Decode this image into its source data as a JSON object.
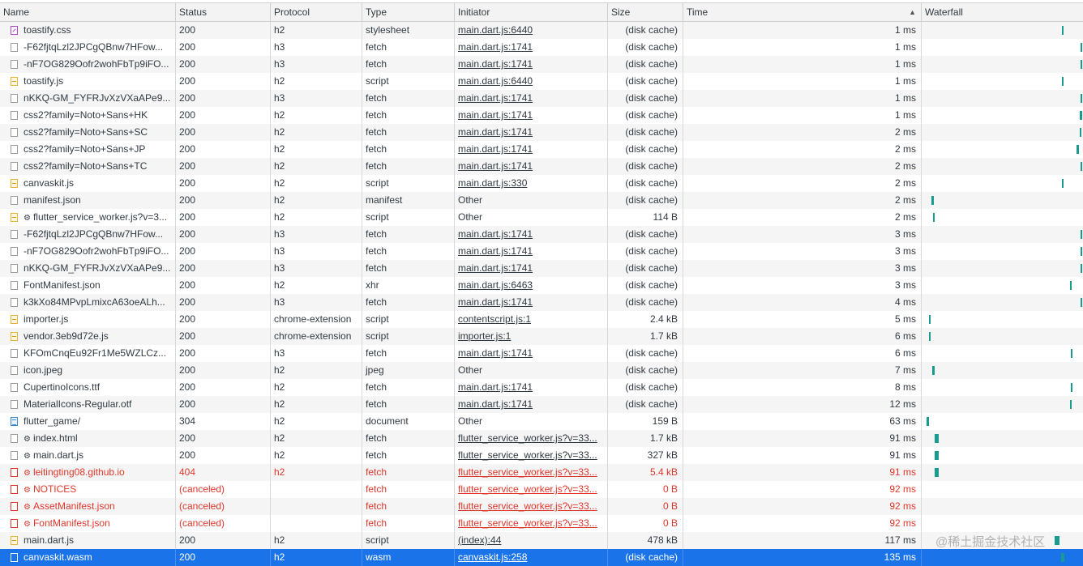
{
  "columns": {
    "name": "Name",
    "status": "Status",
    "protocol": "Protocol",
    "type": "Type",
    "initiator": "Initiator",
    "size": "Size",
    "time": "Time",
    "waterfall": "Waterfall",
    "sort_icon": "▲"
  },
  "rows": [
    {
      "name": "toastify.css",
      "status": "200",
      "protocol": "h2",
      "type": "stylesheet",
      "initiator": "main.dart.js:6440",
      "size": "(disk cache)",
      "time": "1 ms",
      "icon": "css-file-icon",
      "gear": false,
      "link": true,
      "error": false
    },
    {
      "name": "-F62fjtqLzl2JPCgQBnw7HFow...",
      "status": "200",
      "protocol": "h3",
      "type": "fetch",
      "initiator": "main.dart.js:1741",
      "size": "(disk cache)",
      "time": "1 ms",
      "icon": "file-icon",
      "gear": false,
      "link": true,
      "error": false
    },
    {
      "name": "-nF7OG829Oofr2wohFbTp9iFO...",
      "status": "200",
      "protocol": "h3",
      "type": "fetch",
      "initiator": "main.dart.js:1741",
      "size": "(disk cache)",
      "time": "1 ms",
      "icon": "file-icon",
      "gear": false,
      "link": true,
      "error": false
    },
    {
      "name": "toastify.js",
      "status": "200",
      "protocol": "h2",
      "type": "script",
      "initiator": "main.dart.js:6440",
      "size": "(disk cache)",
      "time": "1 ms",
      "icon": "script-file-icon",
      "gear": false,
      "link": true,
      "error": false
    },
    {
      "name": "nKKQ-GM_FYFRJvXzVXaAPe9...",
      "status": "200",
      "protocol": "h3",
      "type": "fetch",
      "initiator": "main.dart.js:1741",
      "size": "(disk cache)",
      "time": "1 ms",
      "icon": "file-icon",
      "gear": false,
      "link": true,
      "error": false
    },
    {
      "name": "css2?family=Noto+Sans+HK",
      "status": "200",
      "protocol": "h2",
      "type": "fetch",
      "initiator": "main.dart.js:1741",
      "size": "(disk cache)",
      "time": "1 ms",
      "icon": "file-icon",
      "gear": false,
      "link": true,
      "error": false
    },
    {
      "name": "css2?family=Noto+Sans+SC",
      "status": "200",
      "protocol": "h2",
      "type": "fetch",
      "initiator": "main.dart.js:1741",
      "size": "(disk cache)",
      "time": "2 ms",
      "icon": "file-icon",
      "gear": false,
      "link": true,
      "error": false
    },
    {
      "name": "css2?family=Noto+Sans+JP",
      "status": "200",
      "protocol": "h2",
      "type": "fetch",
      "initiator": "main.dart.js:1741",
      "size": "(disk cache)",
      "time": "2 ms",
      "icon": "file-icon",
      "gear": false,
      "link": true,
      "error": false
    },
    {
      "name": "css2?family=Noto+Sans+TC",
      "status": "200",
      "protocol": "h2",
      "type": "fetch",
      "initiator": "main.dart.js:1741",
      "size": "(disk cache)",
      "time": "2 ms",
      "icon": "file-icon",
      "gear": false,
      "link": true,
      "error": false
    },
    {
      "name": "canvaskit.js",
      "status": "200",
      "protocol": "h2",
      "type": "script",
      "initiator": "main.dart.js:330",
      "size": "(disk cache)",
      "time": "2 ms",
      "icon": "script-file-icon",
      "gear": false,
      "link": true,
      "error": false
    },
    {
      "name": "manifest.json",
      "status": "200",
      "protocol": "h2",
      "type": "manifest",
      "initiator": "Other",
      "size": "(disk cache)",
      "time": "2 ms",
      "icon": "file-icon",
      "gear": false,
      "link": false,
      "error": false
    },
    {
      "name": "flutter_service_worker.js?v=3...",
      "status": "200",
      "protocol": "h2",
      "type": "script",
      "initiator": "Other",
      "size": "114 B",
      "time": "2 ms",
      "icon": "script-file-icon",
      "gear": true,
      "link": false,
      "error": false
    },
    {
      "name": "-F62fjtqLzl2JPCgQBnw7HFow...",
      "status": "200",
      "protocol": "h3",
      "type": "fetch",
      "initiator": "main.dart.js:1741",
      "size": "(disk cache)",
      "time": "3 ms",
      "icon": "file-icon",
      "gear": false,
      "link": true,
      "error": false
    },
    {
      "name": "-nF7OG829Oofr2wohFbTp9iFO...",
      "status": "200",
      "protocol": "h3",
      "type": "fetch",
      "initiator": "main.dart.js:1741",
      "size": "(disk cache)",
      "time": "3 ms",
      "icon": "file-icon",
      "gear": false,
      "link": true,
      "error": false
    },
    {
      "name": "nKKQ-GM_FYFRJvXzVXaAPe9...",
      "status": "200",
      "protocol": "h3",
      "type": "fetch",
      "initiator": "main.dart.js:1741",
      "size": "(disk cache)",
      "time": "3 ms",
      "icon": "file-icon",
      "gear": false,
      "link": true,
      "error": false
    },
    {
      "name": "FontManifest.json",
      "status": "200",
      "protocol": "h2",
      "type": "xhr",
      "initiator": "main.dart.js:6463",
      "size": "(disk cache)",
      "time": "3 ms",
      "icon": "file-icon",
      "gear": false,
      "link": true,
      "error": false
    },
    {
      "name": "k3kXo84MPvpLmixcA63oeALh...",
      "status": "200",
      "protocol": "h3",
      "type": "fetch",
      "initiator": "main.dart.js:1741",
      "size": "(disk cache)",
      "time": "4 ms",
      "icon": "file-icon",
      "gear": false,
      "link": true,
      "error": false
    },
    {
      "name": "importer.js",
      "status": "200",
      "protocol": "chrome-extension",
      "type": "script",
      "initiator": "contentscript.js:1",
      "size": "2.4 kB",
      "time": "5 ms",
      "icon": "script-file-icon",
      "gear": false,
      "link": true,
      "error": false
    },
    {
      "name": "vendor.3eb9d72e.js",
      "status": "200",
      "protocol": "chrome-extension",
      "type": "script",
      "initiator": "importer.js:1",
      "size": "1.7 kB",
      "time": "6 ms",
      "icon": "script-file-icon",
      "gear": false,
      "link": true,
      "error": false
    },
    {
      "name": "KFOmCnqEu92Fr1Me5WZLCz...",
      "status": "200",
      "protocol": "h3",
      "type": "fetch",
      "initiator": "main.dart.js:1741",
      "size": "(disk cache)",
      "time": "6 ms",
      "icon": "file-icon",
      "gear": false,
      "link": true,
      "error": false
    },
    {
      "name": "icon.jpeg",
      "status": "200",
      "protocol": "h2",
      "type": "jpeg",
      "initiator": "Other",
      "size": "(disk cache)",
      "time": "7 ms",
      "icon": "file-icon",
      "gear": false,
      "link": false,
      "error": false
    },
    {
      "name": "CupertinoIcons.ttf",
      "status": "200",
      "protocol": "h2",
      "type": "fetch",
      "initiator": "main.dart.js:1741",
      "size": "(disk cache)",
      "time": "8 ms",
      "icon": "file-icon",
      "gear": false,
      "link": true,
      "error": false
    },
    {
      "name": "MaterialIcons-Regular.otf",
      "status": "200",
      "protocol": "h2",
      "type": "fetch",
      "initiator": "main.dart.js:1741",
      "size": "(disk cache)",
      "time": "12 ms",
      "icon": "file-icon",
      "gear": false,
      "link": true,
      "error": false
    },
    {
      "name": "flutter_game/",
      "status": "304",
      "protocol": "h2",
      "type": "document",
      "initiator": "Other",
      "size": "159 B",
      "time": "63 ms",
      "icon": "document-file-icon",
      "gear": false,
      "link": false,
      "error": false
    },
    {
      "name": "index.html",
      "status": "200",
      "protocol": "h2",
      "type": "fetch",
      "initiator": "flutter_service_worker.js?v=33...",
      "size": "1.7 kB",
      "time": "91 ms",
      "icon": "file-icon",
      "gear": true,
      "link": true,
      "error": false
    },
    {
      "name": "main.dart.js",
      "status": "200",
      "protocol": "h2",
      "type": "fetch",
      "initiator": "flutter_service_worker.js?v=33...",
      "size": "327 kB",
      "time": "91 ms",
      "icon": "file-icon",
      "gear": true,
      "link": true,
      "error": false
    },
    {
      "name": "leitingting08.github.io",
      "status": "404",
      "protocol": "h2",
      "type": "fetch",
      "initiator": "flutter_service_worker.js?v=33...",
      "size": "5.4 kB",
      "time": "91 ms",
      "icon": "file-icon",
      "gear": true,
      "link": true,
      "error": true
    },
    {
      "name": "NOTICES",
      "status": "(canceled)",
      "protocol": "",
      "type": "fetch",
      "initiator": "flutter_service_worker.js?v=33...",
      "size": "0 B",
      "time": "92 ms",
      "icon": "file-icon",
      "gear": true,
      "link": true,
      "error": true
    },
    {
      "name": "AssetManifest.json",
      "status": "(canceled)",
      "protocol": "",
      "type": "fetch",
      "initiator": "flutter_service_worker.js?v=33...",
      "size": "0 B",
      "time": "92 ms",
      "icon": "file-icon",
      "gear": true,
      "link": true,
      "error": true
    },
    {
      "name": "FontManifest.json",
      "status": "(canceled)",
      "protocol": "",
      "type": "fetch",
      "initiator": "flutter_service_worker.js?v=33...",
      "size": "0 B",
      "time": "92 ms",
      "icon": "file-icon",
      "gear": true,
      "link": true,
      "error": true
    },
    {
      "name": "main.dart.js",
      "status": "200",
      "protocol": "h2",
      "type": "script",
      "initiator": "(index):44",
      "size": "478 kB",
      "time": "117 ms",
      "icon": "script-file-icon",
      "gear": false,
      "link": true,
      "error": false
    },
    {
      "name": "canvaskit.wasm",
      "status": "200",
      "protocol": "h2",
      "type": "wasm",
      "initiator": "canvaskit.js:258",
      "size": "(disk cache)",
      "time": "135 ms",
      "icon": "file-icon",
      "gear": false,
      "link": true,
      "error": false,
      "selected": true
    }
  ],
  "watermark": "@稀土掘金技术社区",
  "colors": {
    "accent": "#1a73e8",
    "error": "#e0372b",
    "waterfall_bar": "#1a9b8f"
  }
}
